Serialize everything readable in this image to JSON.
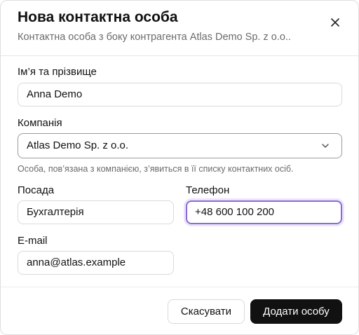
{
  "dialog": {
    "title": "Нова контактна особа",
    "subtitle": "Контактна особа з боку контрагента Atlas Demo Sp. z o.o.."
  },
  "form": {
    "name": {
      "label": "Ім’я та прізвище",
      "value": "Anna Demo"
    },
    "company": {
      "label": "Компанія",
      "value": "Atlas Demo Sp. z o.o.",
      "hint": "Особа, пов’язана з компанією, з’явиться в її списку контактних осіб."
    },
    "position": {
      "label": "Посада",
      "value": "Бухгалтерія"
    },
    "phone": {
      "label": "Телефон",
      "value": "+48 600 100 200"
    },
    "email": {
      "label": "E-mail",
      "value": "anna@atlas.example"
    }
  },
  "footer": {
    "cancel_label": "Скасувати",
    "submit_label": "Додати особу"
  },
  "icons": {
    "close": "close-icon",
    "select_arrow": "chevron-down-icon"
  },
  "colors": {
    "primary_button": "#111111",
    "focus_ring": "#8b6ad6",
    "muted_text": "#6b6b6b"
  }
}
